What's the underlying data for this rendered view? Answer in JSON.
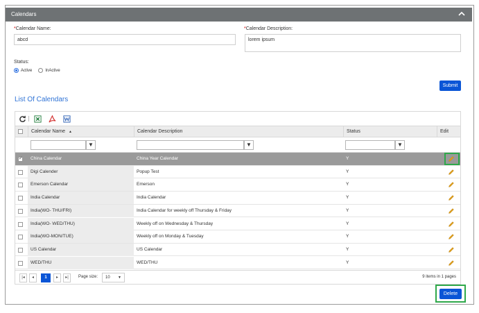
{
  "panel": {
    "title": "Calendars"
  },
  "form": {
    "name_label": "Calendar Name:",
    "name_value": "abcd",
    "description_label": "Calendar Description:",
    "description_value": "lorem ipsum",
    "status_label": "Status:",
    "status_options": [
      "Active",
      "InActive"
    ],
    "status_selected": "Active",
    "submit_label": "Submit"
  },
  "list": {
    "title": "List Of Calendars",
    "columns": [
      "Calendar Name",
      "Calendar Description",
      "Status",
      "Edit"
    ],
    "rows": [
      {
        "name": "China Calendar",
        "description": "China Year Calendar",
        "status": "Y",
        "selected": true
      },
      {
        "name": "Digi Calender",
        "description": "Popup Test",
        "status": "Y",
        "selected": false
      },
      {
        "name": "Emerson Calendar",
        "description": "Emerson",
        "status": "Y",
        "selected": false
      },
      {
        "name": "India Calendar",
        "description": "India Calendar",
        "status": "Y",
        "selected": false
      },
      {
        "name": "India(WO- THU/FRI)",
        "description": "India Calendar for weekly off Thursday & Friday",
        "status": "Y",
        "selected": false
      },
      {
        "name": "India(WO- WED/THU)",
        "description": "Weekly off on Wednesday & Thursday",
        "status": "Y",
        "selected": false
      },
      {
        "name": "India(WO-MON/TUE)",
        "description": "Weekly off on Monday & Tuesday",
        "status": "Y",
        "selected": false
      },
      {
        "name": "US Calendar",
        "description": "US Calendar",
        "status": "Y",
        "selected": false
      },
      {
        "name": "WED/THU",
        "description": "WED/THU",
        "status": "Y",
        "selected": false
      }
    ],
    "pager": {
      "current_page": "1",
      "page_size_label": "Page size:",
      "page_size_value": "10",
      "summary": "9 items in 1 pages"
    }
  },
  "actions": {
    "delete_label": "Delete"
  },
  "colors": {
    "header_bg": "#6e7274",
    "primary": "#0a55d6",
    "link": "#2f73d6",
    "highlight": "#2ea84a",
    "selected_row": "#9a9a9a",
    "edit_icon": "#e0a020"
  }
}
